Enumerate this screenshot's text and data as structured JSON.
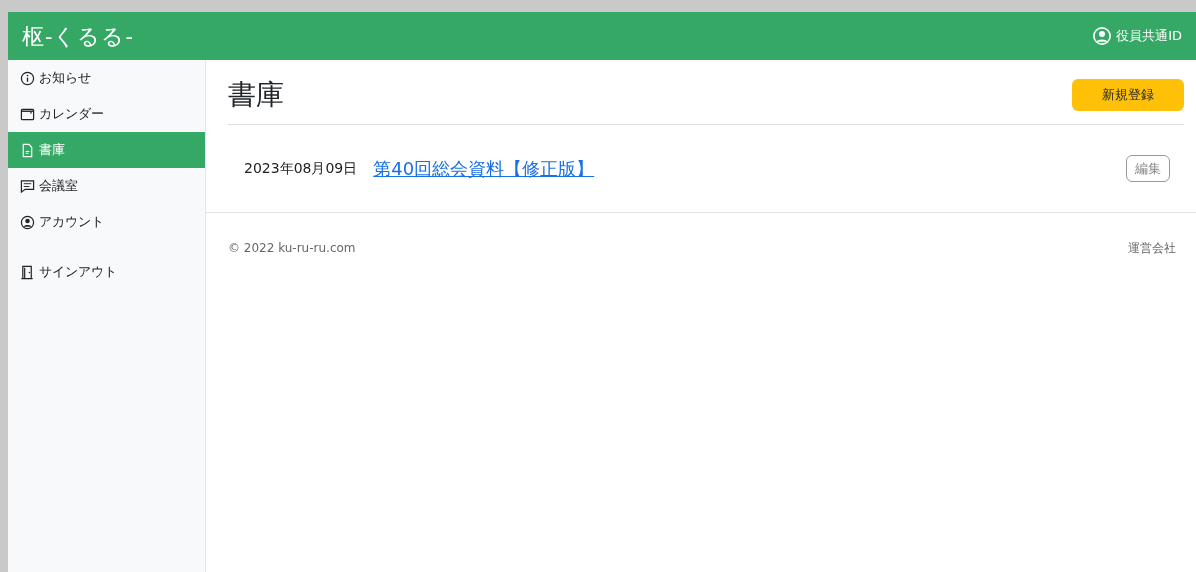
{
  "header": {
    "logo": "枢-くるる-",
    "user": "役員共通ID"
  },
  "sidebar": {
    "items": [
      {
        "label": "お知らせ",
        "selected": false
      },
      {
        "label": "カレンダー",
        "selected": false
      },
      {
        "label": "書庫",
        "selected": true
      },
      {
        "label": "会議室",
        "selected": false
      },
      {
        "label": "アカウント",
        "selected": false
      },
      {
        "label": "サインアウト",
        "selected": false
      }
    ]
  },
  "page": {
    "title": "書庫",
    "new_button": "新規登録"
  },
  "documents": [
    {
      "date": "2023年08月09日",
      "title": "第40回総会資料【修正版】",
      "edit_button": "編集"
    }
  ],
  "footer": {
    "copyright": "© 2022 ku-ru-ru.com",
    "company_link": "運営会社"
  }
}
